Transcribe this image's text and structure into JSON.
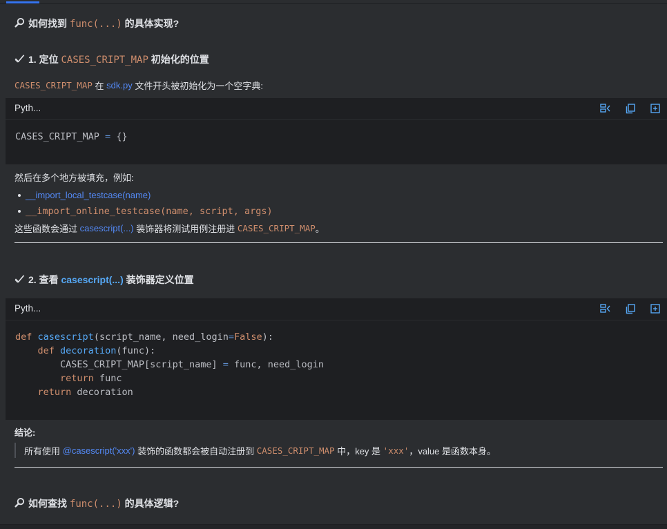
{
  "heading1": {
    "prefix": "如何找到 ",
    "code": "func(...)",
    "suffix": " 的具体实现?"
  },
  "step1": {
    "prefix": "1. 定位 ",
    "code": "CASES_CRIPT_MAP",
    "suffix": " 初始化的位置"
  },
  "para1": {
    "code": "CASES_CRIPT_MAP",
    "t1": " 在 ",
    "link": "sdk.py",
    "t2": " 文件开头被初始化为一个空字典:"
  },
  "code1": {
    "lang": "Pyth...",
    "tools": [
      "wrap-icon",
      "copy-icon",
      "insert-icon"
    ],
    "line1_ident": "CASES_CRIPT_MAP",
    "line1_op": " = ",
    "line1_rest": "{}"
  },
  "para2": {
    "text": "然后在多个地方被填充，例如:"
  },
  "list": {
    "item1": "__import_local_testcase(name)",
    "item2": "__import_online_testcase(name, script, args)"
  },
  "para3": {
    "t1": "这些函数会通过 ",
    "link": "casescript(...)",
    "t2": " 装饰器将测试用例注册进 ",
    "code": "CASES_CRIPT_MAP",
    "t3": "。"
  },
  "step2": {
    "prefix": "2. 查看 ",
    "link": "casescript(...)",
    "suffix": " 装饰器定义位置"
  },
  "code2": {
    "lang": "Pyth...",
    "l1": {
      "kw": "def",
      "fn": "casescript",
      "a": "(script_name, need_login",
      "op": "=",
      "kw2": "False",
      "b": "):"
    },
    "l2": {
      "kw": "def",
      "fn": "decoration",
      "a": "(func):"
    },
    "l3": {
      "a": "CASES_CRIPT_MAP[script_name] ",
      "op": "=",
      "b": " func, need_login"
    },
    "l4": {
      "kw": "return",
      "a": " func"
    },
    "l5": {
      "kw": "return",
      "a": " decoration"
    }
  },
  "conclusion": {
    "label": "结论:",
    "t1": "所有使用 ",
    "link": "@casescript('xxx')",
    "t2": " 装饰的函数都会被自动注册到 ",
    "code": "CASES_CRIPT_MAP",
    "t3": " 中，key 是 ",
    "str": "'xxx'",
    "t4": "，value 是函数本身。"
  },
  "heading2": {
    "prefix": "如何查找 ",
    "code": "func(...)",
    "suffix": " 的具体逻辑?"
  },
  "colors": {
    "accent": "#3574f0",
    "code_orange": "#cf8e6d",
    "link_blue": "#548af7",
    "background": "#2b2d30",
    "code_bg": "#1e1f22"
  }
}
